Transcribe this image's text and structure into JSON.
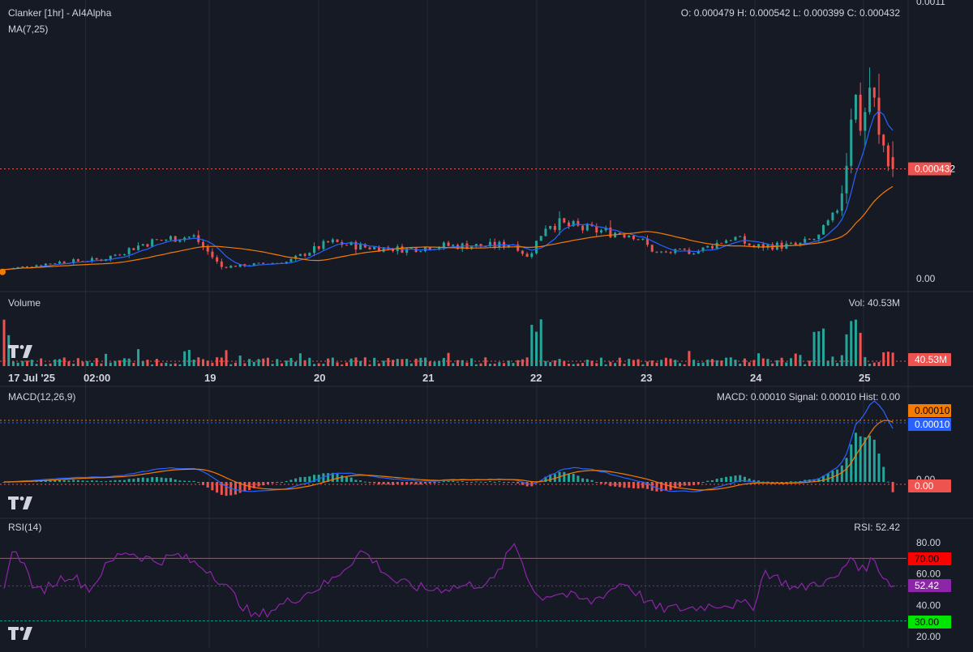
{
  "colors": {
    "background": "#161a25",
    "grid": "#262b38",
    "up": "#26a69a",
    "down": "#ef5350",
    "ma7": "#2962ff",
    "ma25": "#f57c00",
    "macd_line": "#2962ff",
    "signal_line": "#f57c00",
    "rsi_line": "#8e24aa",
    "rsi_upper": "#f23645",
    "rsi_lower": "#089981",
    "text": "#d1d4dc"
  },
  "header": {
    "title": "Clanker [1hr] - AI4Alpha",
    "ohlc": "O: 0.000479 H: 0.000542 L: 0.000399 C: 0.000432",
    "ma_label": "MA(7,25)"
  },
  "price_axis": {
    "top_tick": "0.0011",
    "bottom_tick": "0.00",
    "last_price_badge": "0.000432"
  },
  "volume_panel": {
    "label": "Volume",
    "value_text": "Vol: 40.53M",
    "badge": "40.53M"
  },
  "date_axis": {
    "labels": [
      "17 Jul '25",
      "02:00",
      "19",
      "20",
      "21",
      "22",
      "23",
      "24",
      "25"
    ]
  },
  "macd_panel": {
    "label": "MACD(12,26,9)",
    "value_text": "MACD: 0.00010 Signal: 0.00010 Hist: 0.00",
    "badge_signal": "0.00010",
    "badge_macd": "0.00010",
    "badge_zero": "0.00",
    "zero_tick": "0.00"
  },
  "rsi_panel": {
    "label": "RSI(14)",
    "value_text": "RSI: 52.42",
    "ticks": [
      "80.00",
      "60.00",
      "40.00",
      "20.00"
    ],
    "badge_upper": "70.00",
    "badge_current": "52.42",
    "badge_lower": "30.00"
  },
  "chart_data": {
    "type": "candlestick",
    "interval": "1h",
    "x_range": [
      "2025-07-17",
      "2025-07-25"
    ],
    "price_ylim": [
      0,
      0.0011
    ],
    "price_anchor_days": [
      0.0,
      0.5,
      0.9,
      1.3,
      1.6,
      1.75,
      2.0,
      2.6,
      3.0,
      3.3,
      3.7,
      4.0,
      4.5,
      4.7,
      4.82,
      5.0,
      5.35,
      5.8,
      6.0,
      6.4,
      6.7,
      6.9,
      7.0,
      7.3,
      7.5,
      7.65,
      7.7,
      7.75,
      7.8,
      7.85,
      7.9,
      7.95,
      8.0,
      8.05,
      8.1,
      8.15,
      8.18
    ],
    "price_anchor_values": [
      3e-05,
      6e-05,
      7e-05,
      0.000135,
      0.00016,
      0.00016,
      4e-05,
      6e-05,
      0.00014,
      0.00012,
      0.00011,
      0.000125,
      0.000125,
      0.000135,
      7.5e-05,
      0.00022,
      0.00019,
      0.00017,
      9.5e-05,
      0.000105,
      0.00016,
      0.00012,
      0.000125,
      0.000125,
      0.00016,
      0.00025,
      0.00032,
      0.00045,
      0.00068,
      0.00072,
      0.00055,
      0.00078,
      0.00072,
      0.00055,
      0.00052,
      0.00045,
      0.00043
    ],
    "last_price": 0.000432,
    "last_ohlc": {
      "open": 0.000479,
      "high": 0.000542,
      "low": 0.000399,
      "close": 0.000432
    },
    "volume_last": "40.53M",
    "volume_spikes_days": [
      0.0,
      4.9,
      7.5,
      7.8,
      7.85
    ],
    "macd_last": 0.0001,
    "signal_last": 0.0001,
    "hist_last": 0.0,
    "rsi_anchor_days": [
      0.0,
      0.1,
      0.3,
      0.6,
      0.8,
      0.9,
      1.1,
      1.4,
      1.6,
      1.9,
      2.0,
      2.3,
      2.7,
      3.0,
      3.3,
      3.6,
      3.9,
      4.2,
      4.5,
      4.7,
      4.9,
      5.1,
      5.4,
      5.7,
      6.0,
      6.3,
      6.6,
      6.9,
      7.0,
      7.3,
      7.5,
      7.6,
      7.7,
      7.8,
      7.9,
      8.0,
      8.1,
      8.2
    ],
    "rsi_anchor_values": [
      54,
      78,
      48,
      60,
      50,
      62,
      75,
      68,
      72,
      62,
      55,
      32,
      45,
      55,
      75,
      55,
      50,
      52,
      55,
      80,
      45,
      48,
      42,
      55,
      38,
      38,
      41,
      40,
      62,
      50,
      55,
      55,
      60,
      72,
      62,
      70,
      58,
      52
    ],
    "rsi_last": 52.42,
    "rsi_upper": 70,
    "rsi_lower": 30,
    "rsi_ticks": [
      80,
      60,
      40,
      20
    ]
  }
}
